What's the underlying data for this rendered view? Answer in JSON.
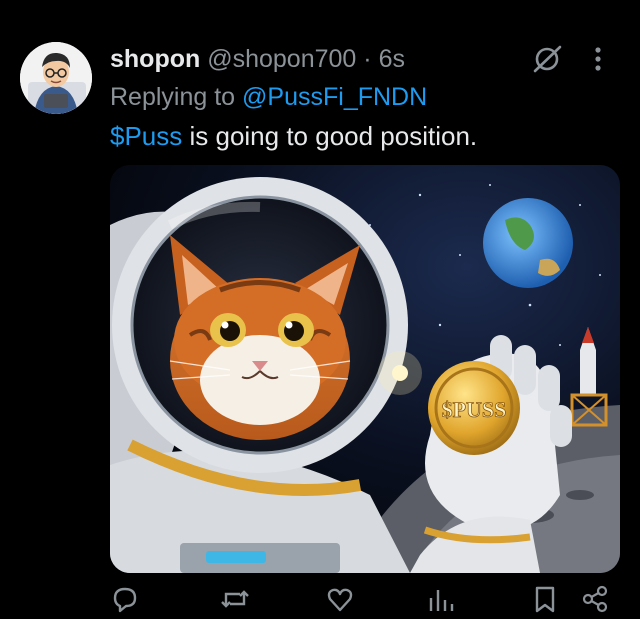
{
  "author": {
    "display_name": "shopon",
    "handle": "@shopon700",
    "separator": "·",
    "time": "6s"
  },
  "reply": {
    "prefix": "Replying to",
    "target": "@PussFi_FNDN"
  },
  "tweet": {
    "cashtag": "$Puss",
    "text": " is going to good position."
  },
  "media": {
    "coin_text": "$PUSS",
    "icon": "image"
  },
  "actions": [
    {
      "icon": "reply-icon"
    },
    {
      "icon": "retweet-icon"
    },
    {
      "icon": "like-icon"
    },
    {
      "icon": "views-icon"
    },
    {
      "icon": "bookmark-icon"
    },
    {
      "icon": "share-icon"
    }
  ],
  "colors": {
    "background": "#000000",
    "link": "#1d9bf0",
    "muted": "#8b9298",
    "text": "#e7e9ea"
  }
}
